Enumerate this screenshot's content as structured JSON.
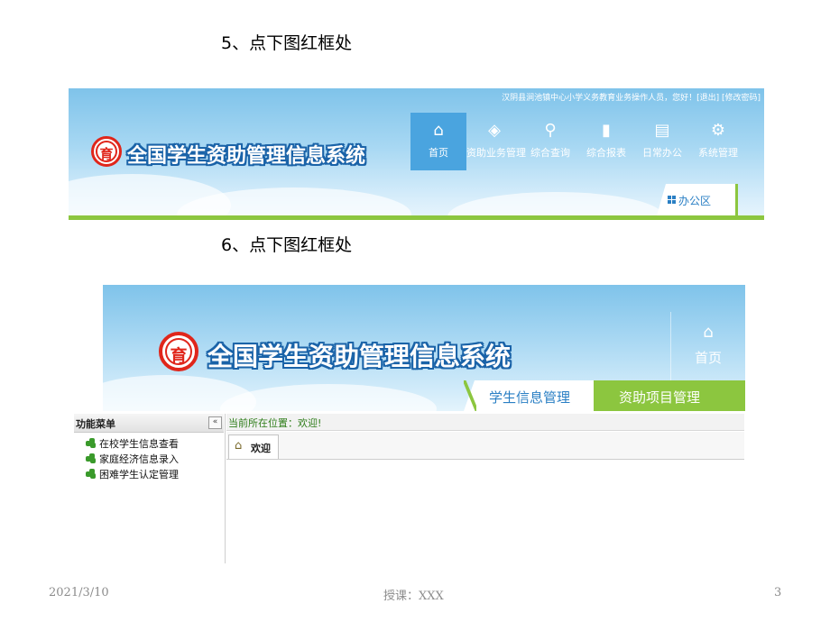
{
  "steps": {
    "step5": "5、点下图红框处",
    "step6": "6、点下图红框处"
  },
  "shot1": {
    "user_line": "汉阴县涧池镇中心小学义务教育业务操作人员，您好！[退出] [修改密码]",
    "system_title": "全国学生资助管理信息系统",
    "logo_glyph": "育",
    "nav": [
      {
        "label": "首页",
        "icon": "home-icon",
        "glyph": "⌂",
        "active": true
      },
      {
        "label": "资助业务管理",
        "icon": "diamond-icon",
        "glyph": "◈",
        "active": false
      },
      {
        "label": "综合查询",
        "icon": "search-icon",
        "glyph": "⚲",
        "active": false
      },
      {
        "label": "综合报表",
        "icon": "bar-chart-icon",
        "glyph": "▮",
        "active": false
      },
      {
        "label": "日常办公",
        "icon": "document-icon",
        "glyph": "▤",
        "active": false
      },
      {
        "label": "系统管理",
        "icon": "gear-icon",
        "glyph": "⚙",
        "active": false
      }
    ],
    "office_tab": "办公区"
  },
  "shot2": {
    "system_title": "全国学生资助管理信息系统",
    "logo_glyph": "育",
    "home_label": "首页",
    "tab_student_info": "学生信息管理",
    "tab_aid_project": "资助项目管理",
    "menu_title": "功能菜单",
    "collapse": "«",
    "menu_items": [
      "在校学生信息查看",
      "家庭经济信息录入",
      "困难学生认定管理"
    ],
    "location": "当前所在位置：欢迎!",
    "welcome_tab": "欢迎"
  },
  "footer": {
    "date": "2021/3/10",
    "teacher": "授课：XXX",
    "page": "3"
  },
  "colors": {
    "accent_green": "#8cc63f",
    "header_blue": "#7fc3ea",
    "logo_red": "#e0261b",
    "title_outline": "#1a63a8"
  }
}
